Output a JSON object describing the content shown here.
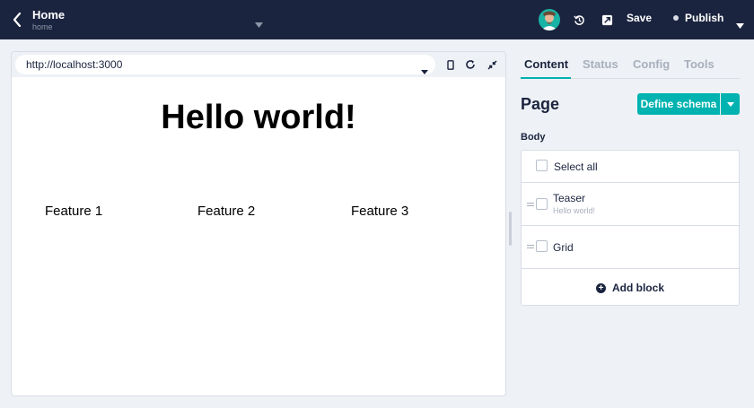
{
  "topbar": {
    "title": "Home",
    "slug": "home",
    "save_label": "Save",
    "publish_label": "Publish"
  },
  "preview": {
    "url": "http://localhost:3000",
    "heading": "Hello world!",
    "features": [
      "Feature 1",
      "Feature 2",
      "Feature 3"
    ]
  },
  "panel": {
    "tabs": [
      {
        "label": "Content",
        "active": true
      },
      {
        "label": "Status",
        "active": false
      },
      {
        "label": "Config",
        "active": false
      },
      {
        "label": "Tools",
        "active": false
      }
    ],
    "page_heading": "Page",
    "define_schema_label": "Define schema",
    "body_label": "Body",
    "select_all_label": "Select all",
    "blocks": [
      {
        "name": "Teaser",
        "preview": "Hello world!"
      },
      {
        "name": "Grid",
        "preview": ""
      }
    ],
    "add_block_label": "Add block"
  },
  "colors": {
    "topbar": "#1b243f",
    "accent": "#00b3b0",
    "background": "#eef1f5"
  },
  "icons": [
    "back-icon",
    "chevron-down-icon",
    "history-icon",
    "open-external-icon",
    "mobile-icon",
    "refresh-icon",
    "collapse-icon",
    "drag-handle-icon",
    "plus-circle-icon"
  ]
}
